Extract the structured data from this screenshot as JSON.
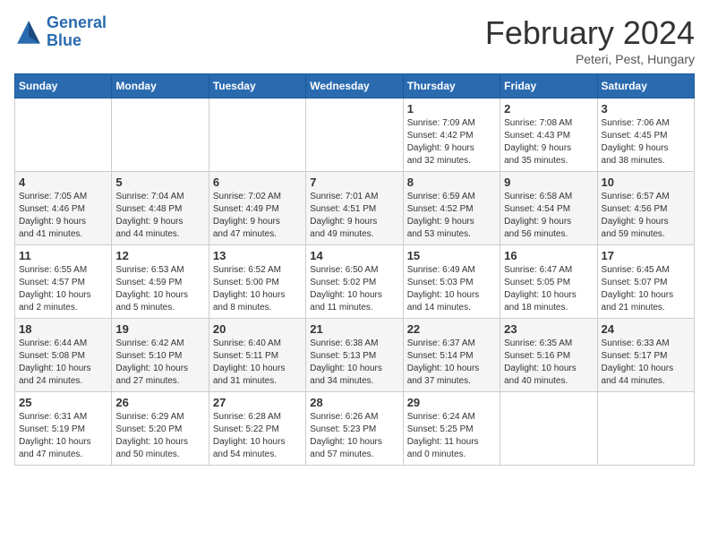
{
  "header": {
    "logo_line1": "General",
    "logo_line2": "Blue",
    "title": "February 2024",
    "subtitle": "Peteri, Pest, Hungary"
  },
  "days_of_week": [
    "Sunday",
    "Monday",
    "Tuesday",
    "Wednesday",
    "Thursday",
    "Friday",
    "Saturday"
  ],
  "weeks": [
    [
      {
        "day": "",
        "info": ""
      },
      {
        "day": "",
        "info": ""
      },
      {
        "day": "",
        "info": ""
      },
      {
        "day": "",
        "info": ""
      },
      {
        "day": "1",
        "info": "Sunrise: 7:09 AM\nSunset: 4:42 PM\nDaylight: 9 hours\nand 32 minutes."
      },
      {
        "day": "2",
        "info": "Sunrise: 7:08 AM\nSunset: 4:43 PM\nDaylight: 9 hours\nand 35 minutes."
      },
      {
        "day": "3",
        "info": "Sunrise: 7:06 AM\nSunset: 4:45 PM\nDaylight: 9 hours\nand 38 minutes."
      }
    ],
    [
      {
        "day": "4",
        "info": "Sunrise: 7:05 AM\nSunset: 4:46 PM\nDaylight: 9 hours\nand 41 minutes."
      },
      {
        "day": "5",
        "info": "Sunrise: 7:04 AM\nSunset: 4:48 PM\nDaylight: 9 hours\nand 44 minutes."
      },
      {
        "day": "6",
        "info": "Sunrise: 7:02 AM\nSunset: 4:49 PM\nDaylight: 9 hours\nand 47 minutes."
      },
      {
        "day": "7",
        "info": "Sunrise: 7:01 AM\nSunset: 4:51 PM\nDaylight: 9 hours\nand 49 minutes."
      },
      {
        "day": "8",
        "info": "Sunrise: 6:59 AM\nSunset: 4:52 PM\nDaylight: 9 hours\nand 53 minutes."
      },
      {
        "day": "9",
        "info": "Sunrise: 6:58 AM\nSunset: 4:54 PM\nDaylight: 9 hours\nand 56 minutes."
      },
      {
        "day": "10",
        "info": "Sunrise: 6:57 AM\nSunset: 4:56 PM\nDaylight: 9 hours\nand 59 minutes."
      }
    ],
    [
      {
        "day": "11",
        "info": "Sunrise: 6:55 AM\nSunset: 4:57 PM\nDaylight: 10 hours\nand 2 minutes."
      },
      {
        "day": "12",
        "info": "Sunrise: 6:53 AM\nSunset: 4:59 PM\nDaylight: 10 hours\nand 5 minutes."
      },
      {
        "day": "13",
        "info": "Sunrise: 6:52 AM\nSunset: 5:00 PM\nDaylight: 10 hours\nand 8 minutes."
      },
      {
        "day": "14",
        "info": "Sunrise: 6:50 AM\nSunset: 5:02 PM\nDaylight: 10 hours\nand 11 minutes."
      },
      {
        "day": "15",
        "info": "Sunrise: 6:49 AM\nSunset: 5:03 PM\nDaylight: 10 hours\nand 14 minutes."
      },
      {
        "day": "16",
        "info": "Sunrise: 6:47 AM\nSunset: 5:05 PM\nDaylight: 10 hours\nand 18 minutes."
      },
      {
        "day": "17",
        "info": "Sunrise: 6:45 AM\nSunset: 5:07 PM\nDaylight: 10 hours\nand 21 minutes."
      }
    ],
    [
      {
        "day": "18",
        "info": "Sunrise: 6:44 AM\nSunset: 5:08 PM\nDaylight: 10 hours\nand 24 minutes."
      },
      {
        "day": "19",
        "info": "Sunrise: 6:42 AM\nSunset: 5:10 PM\nDaylight: 10 hours\nand 27 minutes."
      },
      {
        "day": "20",
        "info": "Sunrise: 6:40 AM\nSunset: 5:11 PM\nDaylight: 10 hours\nand 31 minutes."
      },
      {
        "day": "21",
        "info": "Sunrise: 6:38 AM\nSunset: 5:13 PM\nDaylight: 10 hours\nand 34 minutes."
      },
      {
        "day": "22",
        "info": "Sunrise: 6:37 AM\nSunset: 5:14 PM\nDaylight: 10 hours\nand 37 minutes."
      },
      {
        "day": "23",
        "info": "Sunrise: 6:35 AM\nSunset: 5:16 PM\nDaylight: 10 hours\nand 40 minutes."
      },
      {
        "day": "24",
        "info": "Sunrise: 6:33 AM\nSunset: 5:17 PM\nDaylight: 10 hours\nand 44 minutes."
      }
    ],
    [
      {
        "day": "25",
        "info": "Sunrise: 6:31 AM\nSunset: 5:19 PM\nDaylight: 10 hours\nand 47 minutes."
      },
      {
        "day": "26",
        "info": "Sunrise: 6:29 AM\nSunset: 5:20 PM\nDaylight: 10 hours\nand 50 minutes."
      },
      {
        "day": "27",
        "info": "Sunrise: 6:28 AM\nSunset: 5:22 PM\nDaylight: 10 hours\nand 54 minutes."
      },
      {
        "day": "28",
        "info": "Sunrise: 6:26 AM\nSunset: 5:23 PM\nDaylight: 10 hours\nand 57 minutes."
      },
      {
        "day": "29",
        "info": "Sunrise: 6:24 AM\nSunset: 5:25 PM\nDaylight: 11 hours\nand 0 minutes."
      },
      {
        "day": "",
        "info": ""
      },
      {
        "day": "",
        "info": ""
      }
    ]
  ]
}
